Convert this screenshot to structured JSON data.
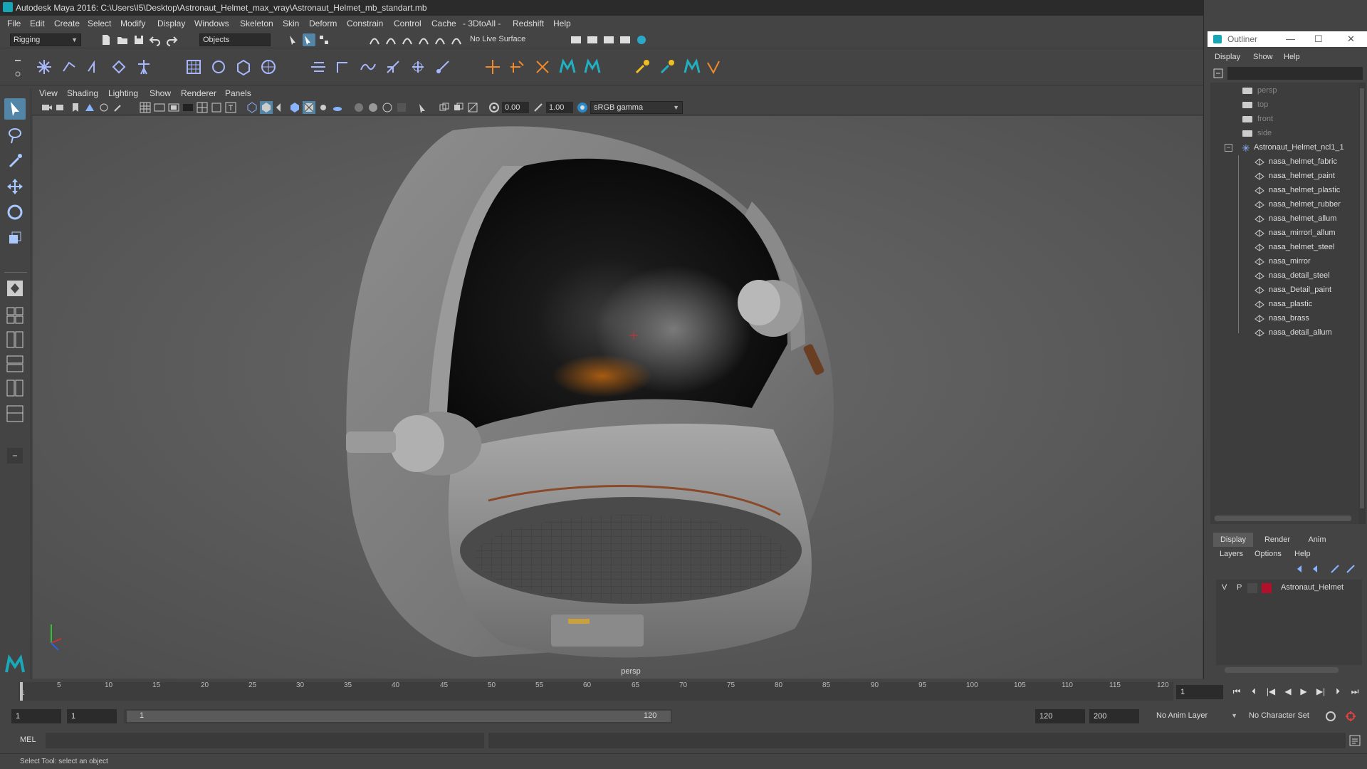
{
  "window": {
    "title": "Autodesk Maya 2016: C:\\Users\\I5\\Desktop\\Astronaut_Helmet_max_vray\\Astronaut_Helmet_mb_standart.mb",
    "minimize": "—",
    "restore": "❐",
    "close": "✕"
  },
  "menubar": [
    "File",
    "Edit",
    "Create",
    "Select",
    "Modify",
    "Display",
    "Windows",
    "Skeleton",
    "Skin",
    "Deform",
    "Constrain",
    "Control",
    "Cache",
    "- 3DtoAll -",
    "Redshift",
    "Help"
  ],
  "statusline": {
    "menuset": "Rigging",
    "selection_mode": "Objects",
    "live_surface": "No Live Surface"
  },
  "panel_menu": [
    "View",
    "Shading",
    "Lighting",
    "Show",
    "Renderer",
    "Panels"
  ],
  "panel_toolbar": {
    "exposure": "0.00",
    "gamma": "1.00",
    "color_space": "sRGB gamma"
  },
  "viewport": {
    "camera_label": "persp"
  },
  "outliner": {
    "title": "Outliner",
    "menu": [
      "Display",
      "Show",
      "Help"
    ],
    "cameras": [
      "persp",
      "top",
      "front",
      "side"
    ],
    "group": "Astronaut_Helmet_ncl1_1",
    "children": [
      "nasa_helmet_fabric",
      "nasa_helmet_paint",
      "nasa_helmet_plastic",
      "nasa_helmet_rubber",
      "nasa_helmet_allum",
      "nasa_mirrorl_allum",
      "nasa_helmet_steel",
      "nasa_mirror",
      "nasa_detail_steel",
      "nasa_Detail_paint",
      "nasa_plastic",
      "nasa_brass",
      "nasa_detail_allum"
    ]
  },
  "layer_editor": {
    "tabs": [
      "Display",
      "Render",
      "Anim"
    ],
    "menu": [
      "Layers",
      "Options",
      "Help"
    ],
    "layer": {
      "visible": "V",
      "playback": "P",
      "name": "Astronaut_Helmet",
      "color": "#b0102a"
    }
  },
  "timeline": {
    "ticks": [
      "5",
      "10",
      "15",
      "20",
      "25",
      "30",
      "35",
      "40",
      "45",
      "50",
      "55",
      "60",
      "65",
      "70",
      "75",
      "80",
      "85",
      "90",
      "95",
      "100",
      "105",
      "110",
      "115",
      "120"
    ],
    "start_tick": "1",
    "current_frame": "1"
  },
  "range": {
    "start": "1",
    "playback_start": "1",
    "slider_start": "1",
    "slider_end": "120",
    "playback_end": "120",
    "end": "200",
    "anim_layer": "No Anim Layer",
    "character_set": "No Character Set"
  },
  "command_line": {
    "language": "MEL"
  },
  "help_line": {
    "text": "Select Tool: select an object"
  },
  "colors": {
    "accent": "#5285a6",
    "maya_teal": "#16a6b6"
  }
}
